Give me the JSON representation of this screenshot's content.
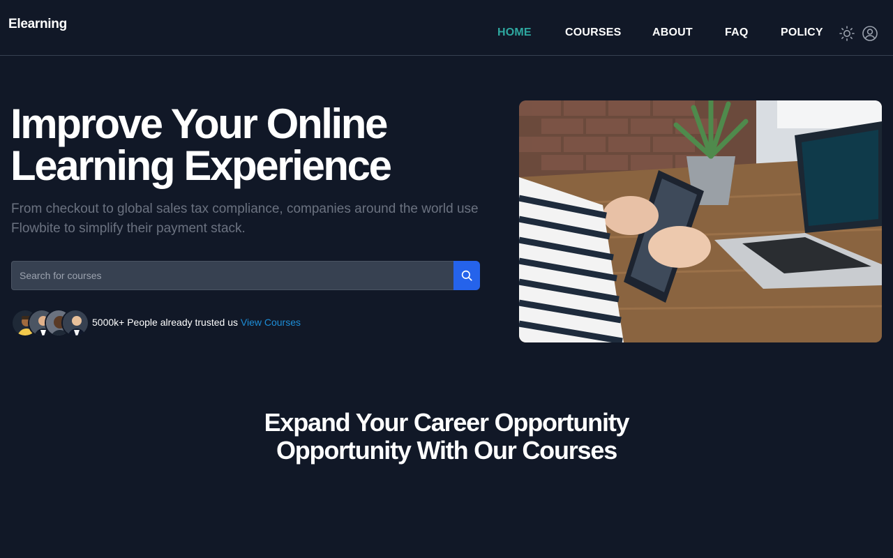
{
  "brand": "Elearning",
  "nav": {
    "items": [
      {
        "label": "HOME",
        "active": true
      },
      {
        "label": "COURSES",
        "active": false
      },
      {
        "label": "ABOUT",
        "active": false
      },
      {
        "label": "FAQ",
        "active": false
      },
      {
        "label": "POLICY",
        "active": false
      }
    ],
    "icons": [
      "sun-icon",
      "user-icon"
    ]
  },
  "hero": {
    "title_line1": "Improve Your Online",
    "title_line2": "Learning Experience",
    "subtitle": "From checkout to global sales tax compliance, companies around the world use Flowbite to simplify their payment stack.",
    "search_placeholder": "Search for courses",
    "trust_text": "5000k+ People already trusted us",
    "trust_link": "View Courses"
  },
  "section": {
    "title_line1": "Expand Your Career Opportunity",
    "title_line2": "Opportunity With Our Courses"
  },
  "colors": {
    "background": "#111827",
    "active_nav": "#2ea8a0",
    "accent": "#2563eb",
    "link": "#1d8ed8"
  }
}
